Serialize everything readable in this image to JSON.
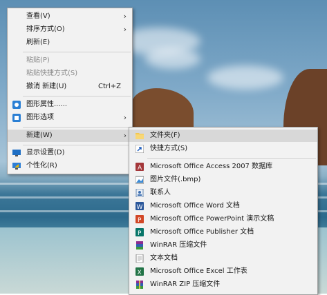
{
  "desktop_menu": {
    "items": [
      {
        "label": "查看(V)",
        "has_submenu": true
      },
      {
        "label": "排序方式(O)",
        "has_submenu": true
      },
      {
        "label": "刷新(E)"
      },
      {
        "label": "粘贴(P)",
        "disabled": true
      },
      {
        "label": "粘贴快捷方式(S)",
        "disabled": true
      },
      {
        "label": "撤消 新建(U)",
        "shortcut": "Ctrl+Z"
      },
      {
        "label": "图形属性......",
        "icon": "graphics-properties-icon"
      },
      {
        "label": "图形选项",
        "icon": "graphics-options-icon",
        "has_submenu": true
      },
      {
        "label": "新建(W)",
        "has_submenu": true,
        "highlighted": true
      },
      {
        "label": "显示设置(D)",
        "icon": "display-settings-icon"
      },
      {
        "label": "个性化(R)",
        "icon": "personalize-icon"
      }
    ]
  },
  "new_submenu": {
    "items": [
      {
        "label": "文件夹(F)",
        "icon": "folder-icon",
        "highlighted": true
      },
      {
        "label": "快捷方式(S)",
        "icon": "shortcut-icon"
      },
      {
        "label": "Microsoft Office Access 2007 数据库",
        "icon": "access-icon"
      },
      {
        "label": "图片文件(.bmp)",
        "icon": "bitmap-icon"
      },
      {
        "label": "联系人",
        "icon": "contact-icon"
      },
      {
        "label": "Microsoft Office Word 文档",
        "icon": "word-icon"
      },
      {
        "label": "Microsoft Office PowerPoint 演示文稿",
        "icon": "powerpoint-icon"
      },
      {
        "label": "Microsoft Office Publisher 文档",
        "icon": "publisher-icon"
      },
      {
        "label": "WinRAR 压缩文件",
        "icon": "winrar-icon"
      },
      {
        "label": "文本文档",
        "icon": "text-document-icon"
      },
      {
        "label": "Microsoft Office Excel 工作表",
        "icon": "excel-icon"
      },
      {
        "label": "WinRAR ZIP 压缩文件",
        "icon": "winrar-zip-icon"
      }
    ]
  },
  "colors": {
    "menu_bg": "#f2f2f2",
    "highlight": "#d8d8d8",
    "disabled_text": "#8a8a8a"
  }
}
